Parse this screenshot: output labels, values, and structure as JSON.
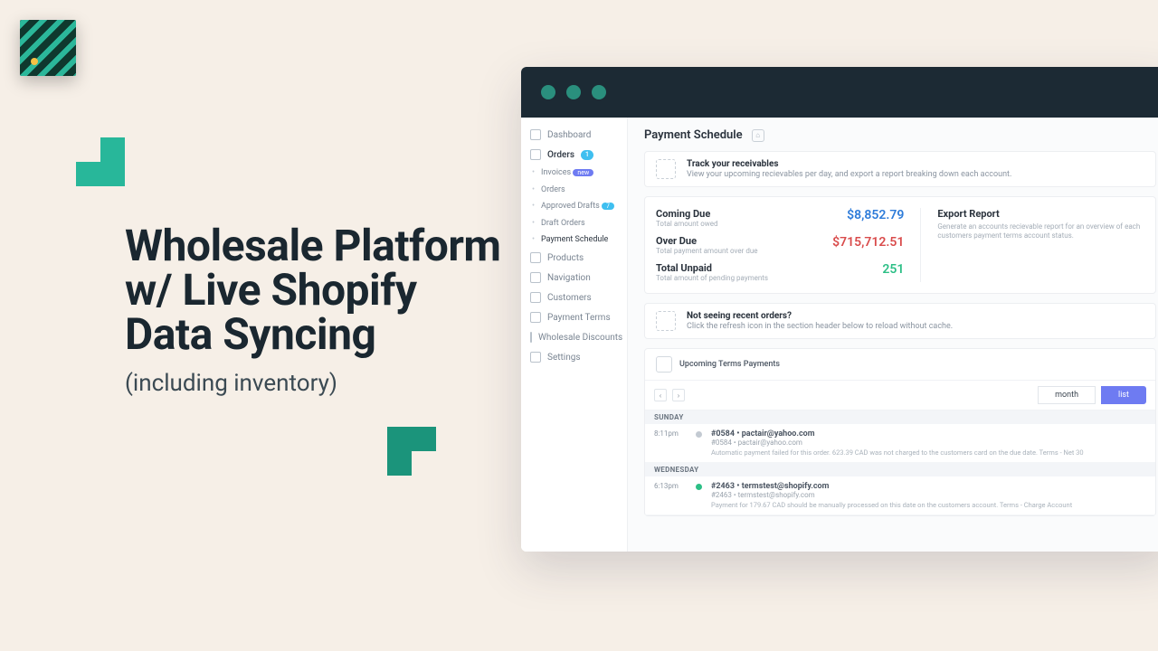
{
  "hero": {
    "title": "Wholesale Platform w/ Live Shopify Data Syncing",
    "subtitle": "(including inventory)"
  },
  "sidebar": {
    "dashboard": "Dashboard",
    "orders": {
      "label": "Orders",
      "badge": "1",
      "invoices": "Invoices",
      "invoices_badge": "new",
      "orders_sub": "Orders",
      "approved": "Approved Drafts",
      "approved_badge": "7",
      "drafts": "Draft Orders",
      "schedule": "Payment Schedule"
    },
    "products": "Products",
    "navigation": "Navigation",
    "customers": "Customers",
    "payment_terms": "Payment Terms",
    "wholesale_discounts": "Wholesale Discounts",
    "settings": "Settings"
  },
  "page": {
    "title": "Payment Schedule",
    "banner1": {
      "title": "Track your receivables",
      "body": "View your upcoming recievables per day, and export a report breaking down each account."
    },
    "metrics": {
      "coming_due": {
        "label": "Coming Due",
        "sub": "Total amount owed",
        "value": "$8,852.79"
      },
      "over_due": {
        "label": "Over Due",
        "sub": "Total payment amount over due",
        "value": "$715,712.51"
      },
      "total": {
        "label": "Total Unpaid",
        "sub": "Total amount of pending payments",
        "value": "251"
      }
    },
    "export": {
      "label": "Export Report",
      "body": "Generate an accounts recievable report for an overview of each customers payment terms account status."
    },
    "banner2": {
      "title": "Not seeing recent orders?",
      "body": "Click the refresh icon in the section header below to reload without cache."
    },
    "terms": {
      "title": "Upcoming Terms Payments",
      "view_month": "month",
      "view_list": "list",
      "days": [
        {
          "name": "SUNDAY",
          "events": [
            {
              "time": "8:11pm",
              "dot": "grey",
              "line1": "#0584 • pactair@yahoo.com",
              "line2": "#0584 • pactair@yahoo.com",
              "note": "Automatic payment failed for this order. 623.39 CAD was not charged to the customers card on the due date. Terms - Net 30"
            }
          ]
        },
        {
          "name": "WEDNESDAY",
          "events": [
            {
              "time": "6:13pm",
              "dot": "grn",
              "line1": "#2463 • termstest@shopify.com",
              "line2": "#2463 • termstest@shopify.com",
              "note": "Payment for 179.67 CAD should be manually processed on this date on the customers account. Terms - Charge Account"
            }
          ]
        }
      ]
    }
  }
}
